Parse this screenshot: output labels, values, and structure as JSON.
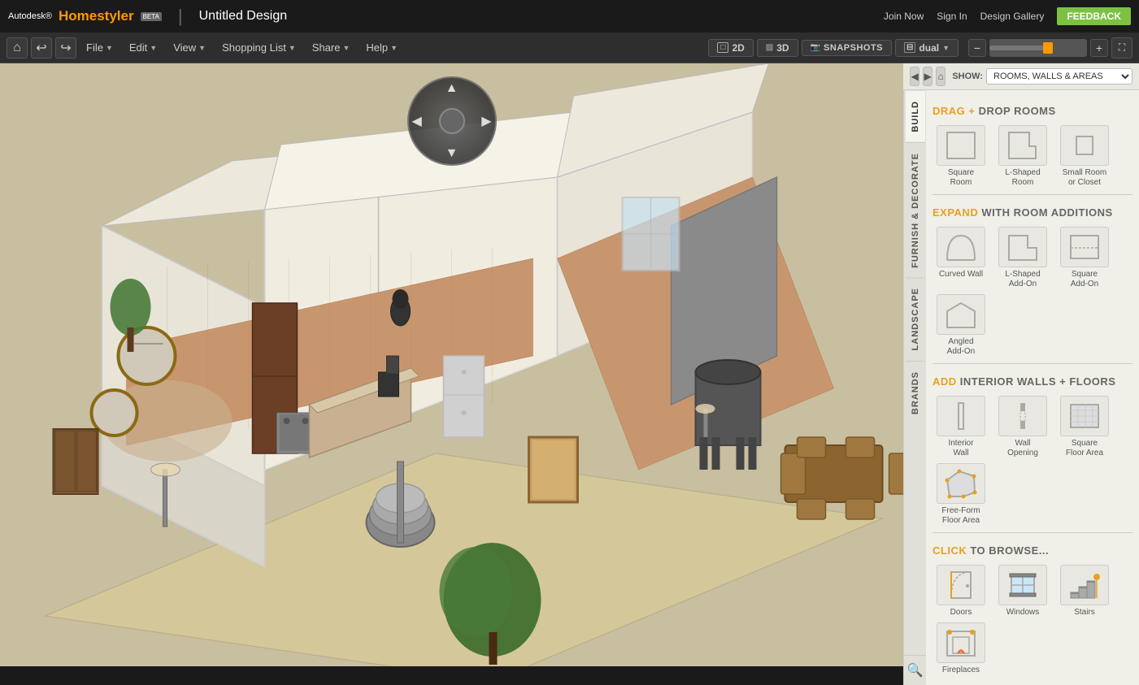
{
  "topbar": {
    "autodesk_label": "Autodesk®",
    "homestyler_label": "Homestyler",
    "beta_label": "BETA",
    "tm_label": "™",
    "divider": "|",
    "design_title": "Untitled Design",
    "links": {
      "join_now": "Join Now",
      "sign_in": "Sign In",
      "design_gallery": "Design Gallery"
    },
    "feedback_label": "FEEDBACK"
  },
  "menubar": {
    "home_icon": "⌂",
    "undo_icon": "↩",
    "redo_icon": "↪",
    "file_label": "File",
    "edit_label": "Edit",
    "view_label": "View",
    "shopping_list_label": "Shopping List",
    "share_label": "Share",
    "help_label": "Help",
    "view_2d_label": "2D",
    "view_3d_label": "3D",
    "snapshots_label": "SNAPSHOTS",
    "dual_label": "dual",
    "zoom_minus": "−",
    "zoom_plus": "+",
    "fullscreen_icon": "⛶"
  },
  "nav_controls": {
    "up": "▲",
    "down": "▼",
    "left": "◀",
    "right": "▶"
  },
  "panel": {
    "nav_back": "◀",
    "nav_forward": "▶",
    "nav_home": "⌂",
    "show_label": "SHOW:",
    "show_option": "ROOMS, WALLS & AREAS",
    "search_placeholder": "Search...",
    "tabs": {
      "build": "BUILD",
      "furnish": "FURNISH & DECORATE",
      "landscape": "LANDSCAPE",
      "brands": "BRANDS"
    },
    "sections": {
      "drag_drop_title": "DRAG + DROP ROOMS",
      "drag": "DRAG",
      "plus": "+",
      "drop": "DROP",
      "rooms": "ROOMS",
      "expand_title": "EXPAND WITH ROOM ADDITIONS",
      "expand": "EXPAND",
      "with_room_additions": "WITH ROOM ADDITIONS",
      "add_title": "ADD INTERIOR WALLS + FLOORS",
      "add": "ADD",
      "interior_walls_floors": "INTERIOR WALLS + FLOORS",
      "click_title": "CLICK TO BROWSE...",
      "click": "CLICK",
      "to_browse": "TO BROWSE..."
    },
    "drag_drop_items": [
      {
        "label": "Square\nRoom",
        "id": "square-room"
      },
      {
        "label": "L-Shaped\nRoom",
        "id": "l-shaped-room"
      },
      {
        "label": "Small Room\nor Closet",
        "id": "small-room"
      }
    ],
    "expand_items": [
      {
        "label": "Curved Wall",
        "id": "curved-wall"
      },
      {
        "label": "L-Shaped\nAdd-On",
        "id": "l-shaped-addon"
      },
      {
        "label": "Square\nAdd-On",
        "id": "square-addon"
      },
      {
        "label": "Angled\nAdd-On",
        "id": "angled-addon"
      }
    ],
    "add_items": [
      {
        "label": "Interior\nWall",
        "id": "interior-wall"
      },
      {
        "label": "Wall\nOpening",
        "id": "wall-opening"
      },
      {
        "label": "Square\nFloor Area",
        "id": "square-floor"
      },
      {
        "label": "Free-Form\nFloor Area",
        "id": "freeform-floor"
      }
    ],
    "click_items": [
      {
        "label": "Doors",
        "id": "doors"
      },
      {
        "label": "Windows",
        "id": "windows"
      },
      {
        "label": "Stairs",
        "id": "stairs"
      },
      {
        "label": "Fireplaces",
        "id": "fireplaces"
      }
    ]
  }
}
